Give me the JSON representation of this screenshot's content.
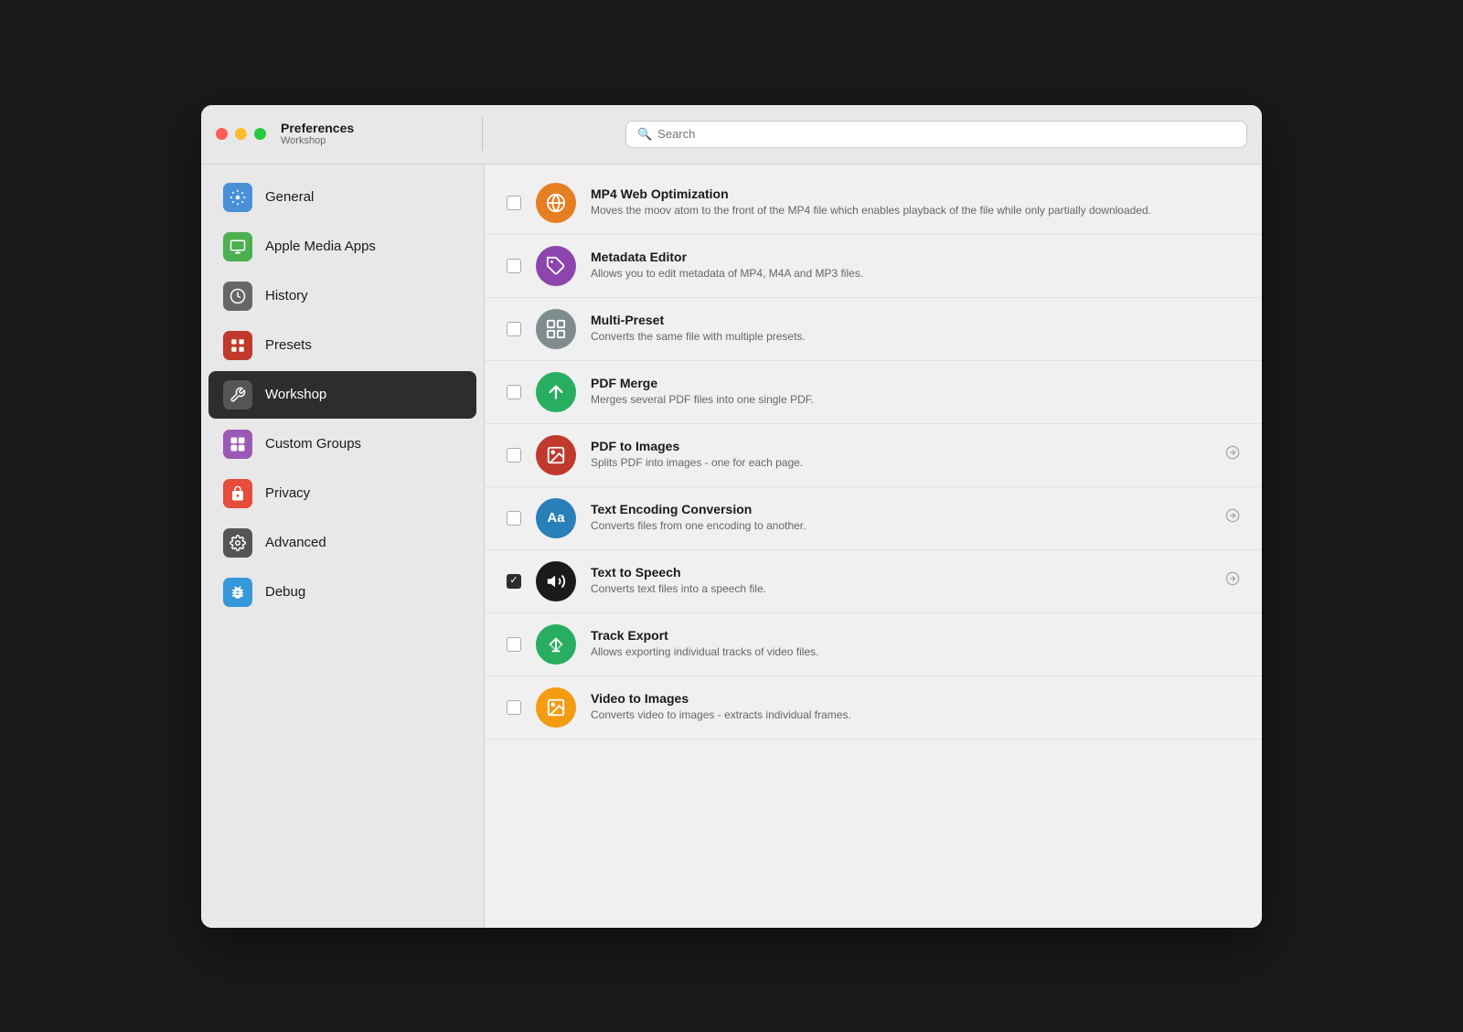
{
  "window": {
    "title": "Preferences",
    "subtitle": "Workshop"
  },
  "search": {
    "placeholder": "Search"
  },
  "sidebar": {
    "items": [
      {
        "id": "general",
        "label": "General",
        "icon_bg": "#4a90d9",
        "icon_char": "⚙️",
        "active": false
      },
      {
        "id": "apple-media-apps",
        "label": "Apple Media Apps",
        "icon_bg": "#4caf50",
        "icon_char": "🖥️",
        "active": false
      },
      {
        "id": "history",
        "label": "History",
        "icon_bg": "#666",
        "icon_char": "🕐",
        "active": false
      },
      {
        "id": "presets",
        "label": "Presets",
        "icon_bg": "#c0392b",
        "icon_char": "⊞",
        "active": false
      },
      {
        "id": "workshop",
        "label": "Workshop",
        "icon_bg": "#555",
        "icon_char": "✂️",
        "active": true
      },
      {
        "id": "custom-groups",
        "label": "Custom Groups",
        "icon_bg": "#9b59b6",
        "icon_char": "⊞",
        "active": false
      },
      {
        "id": "privacy",
        "label": "Privacy",
        "icon_bg": "#e74c3c",
        "icon_char": "✋",
        "active": false
      },
      {
        "id": "advanced",
        "label": "Advanced",
        "icon_bg": "#555",
        "icon_char": "⚙️",
        "active": false
      },
      {
        "id": "debug",
        "label": "Debug",
        "icon_bg": "#3498db",
        "icon_char": "🐛",
        "active": false
      }
    ]
  },
  "plugins": [
    {
      "id": "mp4-web-optimization",
      "name": "MP4 Web Optimization",
      "desc": "Moves the moov atom to the front of the MP4 file which enables playback of the file while only partially downloaded.",
      "icon_bg": "#e67e22",
      "icon_char": "🌐",
      "checked": false,
      "has_arrow": false
    },
    {
      "id": "metadata-editor",
      "name": "Metadata Editor",
      "desc": "Allows you to edit metadata of MP4, M4A and MP3 files.",
      "icon_bg": "#8e44ad",
      "icon_char": "🏷️",
      "checked": false,
      "has_arrow": false
    },
    {
      "id": "multi-preset",
      "name": "Multi-Preset",
      "desc": "Converts the same file with multiple presets.",
      "icon_bg": "#7f8c8d",
      "icon_char": "⊡",
      "checked": false,
      "has_arrow": false
    },
    {
      "id": "pdf-merge",
      "name": "PDF Merge",
      "desc": "Merges several PDF files into one single PDF.",
      "icon_bg": "#27ae60",
      "icon_char": "↑",
      "checked": false,
      "has_arrow": false
    },
    {
      "id": "pdf-to-images",
      "name": "PDF to Images",
      "desc": "Splits PDF into images - one for each page.",
      "icon_bg": "#c0392b",
      "icon_char": "🖼️",
      "checked": false,
      "has_arrow": true
    },
    {
      "id": "text-encoding-conversion",
      "name": "Text Encoding Conversion",
      "desc": "Converts files from one encoding to another.",
      "icon_bg": "#2980b9",
      "icon_char": "Aa",
      "checked": false,
      "has_arrow": true
    },
    {
      "id": "text-to-speech",
      "name": "Text to Speech",
      "desc": "Converts text files into a speech file.",
      "icon_bg": "#1a1a1a",
      "icon_char": "🔊",
      "checked": true,
      "has_arrow": true
    },
    {
      "id": "track-export",
      "name": "Track Export",
      "desc": "Allows exporting individual tracks of video files.",
      "icon_bg": "#27ae60",
      "icon_char": "⑂",
      "checked": false,
      "has_arrow": false
    },
    {
      "id": "video-to-images",
      "name": "Video to Images",
      "desc": "Converts video to images - extracts individual frames.",
      "icon_bg": "#f39c12",
      "icon_char": "🖼️",
      "checked": false,
      "has_arrow": false
    }
  ],
  "icon_colors": {
    "general": "#4a90d9",
    "apple-media-apps": "#4caf50",
    "history": "#555",
    "presets": "#c0392b",
    "workshop": "#444",
    "custom-groups": "#9b59b6",
    "privacy": "#e74c3c",
    "advanced": "#555",
    "debug": "#3498db"
  }
}
